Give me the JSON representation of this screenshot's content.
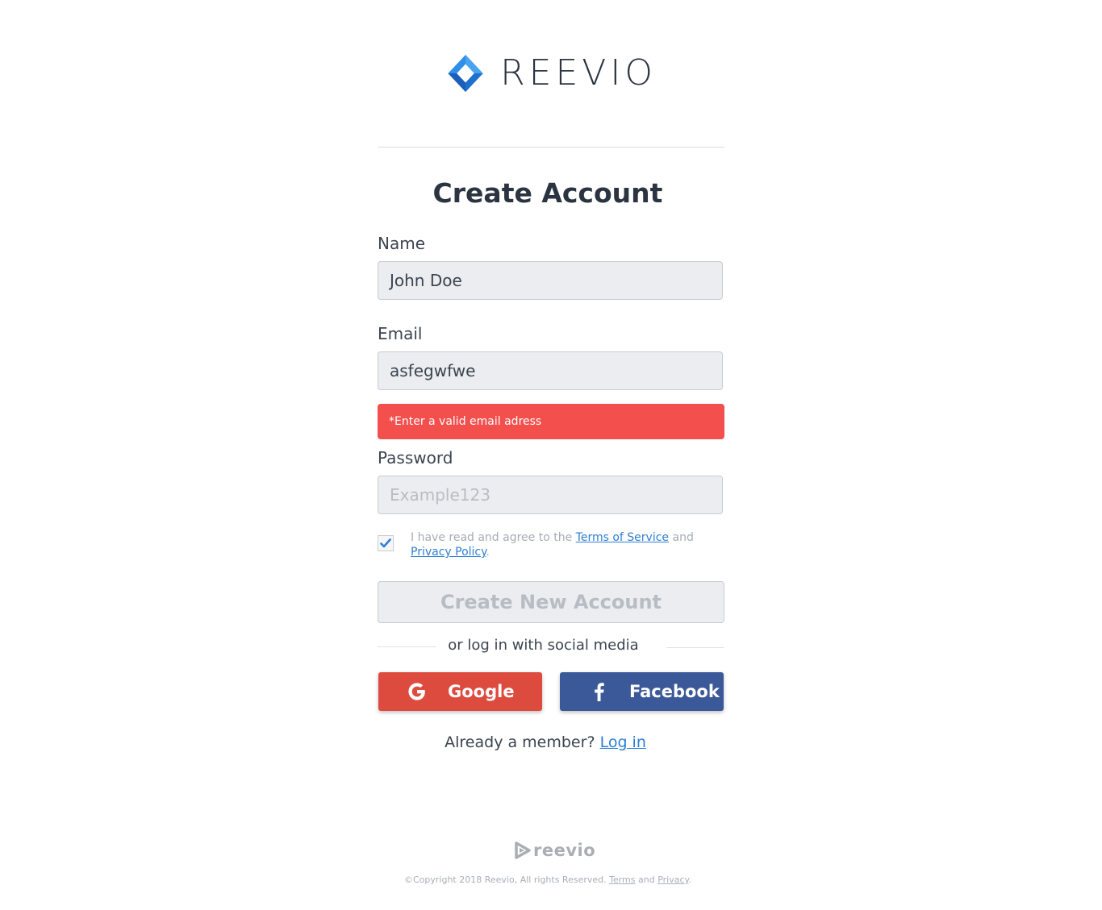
{
  "brand": {
    "name": "REEVIO",
    "colors": {
      "mark_light": "#2f8fe8",
      "mark_dark": "#1b5fb8",
      "text": "#2b3440"
    }
  },
  "form": {
    "title": "Create Account",
    "name_label": "Name",
    "name_value": "John Doe",
    "email_label": "Email",
    "email_value": "asfegwfwe",
    "email_error": "*Enter a valid email adress",
    "password_label": "Password",
    "password_placeholder": "Example123",
    "agree_checked": true,
    "agree_prefix": "I have read and agree to the ",
    "terms_link": "Terms of Service",
    "agree_and": " and",
    "privacy_link": "Privacy Policy",
    "agree_suffix": ".",
    "submit_label": "Create New Account"
  },
  "social": {
    "divider_text": "or log in with social media",
    "google_label": "Google",
    "google_icon": "google-g-icon",
    "google_color": "#dd4b3e",
    "facebook_label": "Facebook",
    "facebook_icon": "facebook-f-icon",
    "facebook_color": "#3b5998"
  },
  "login": {
    "prompt": "Already a member? ",
    "link": "Log in"
  },
  "footer": {
    "logo_text": "reevio",
    "copyright": "©Copyright 2018 Reevio, All rights Reserved. ",
    "terms_link": "Terms",
    "and": " and ",
    "privacy_link": "Privacy",
    "suffix": "."
  },
  "colors": {
    "error_bg": "#f24f4d",
    "link": "#2d7fd3",
    "field_bg": "#ebedf0"
  }
}
